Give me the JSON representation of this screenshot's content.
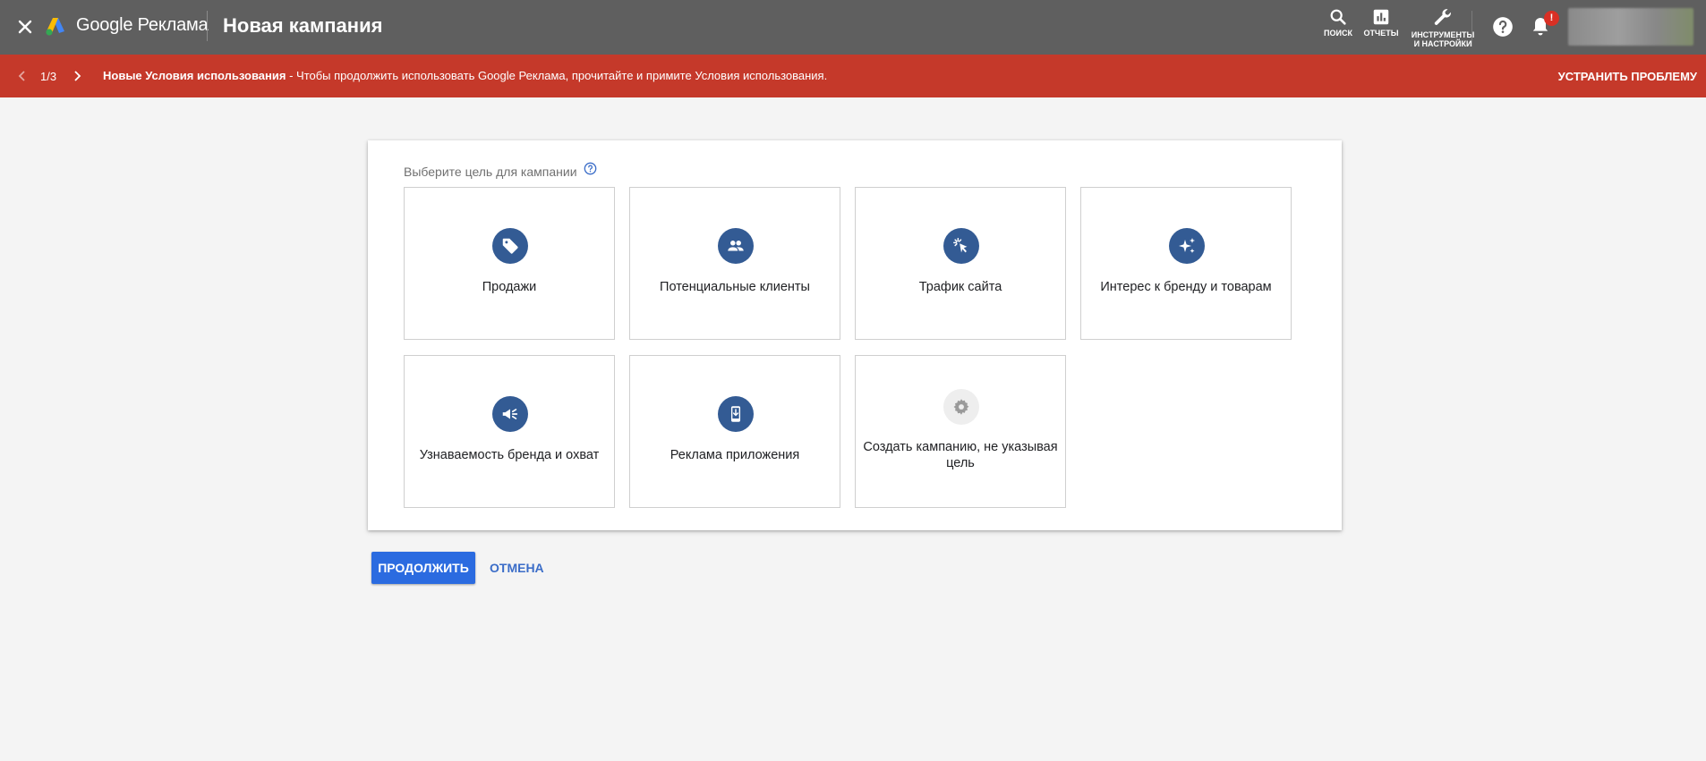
{
  "header": {
    "brand": "Google Реклама",
    "title": "Новая кампания",
    "actions": {
      "search_label": "ПОИСК",
      "reports_label": "ОТЧЕТЫ",
      "tools_label_line1": "ИНСТРУМЕНТЫ",
      "tools_label_line2": "И НАСТРОЙКИ"
    },
    "notification_badge": "!"
  },
  "banner": {
    "counter": "1/3",
    "title": "Новые Условия использования",
    "message": " - Чтобы продолжить использовать Google Реклама, прочитайте и примите Условия использования.",
    "fix_label": "УСТРАНИТЬ ПРОБЛЕМУ",
    "color": "#c5392a"
  },
  "main": {
    "prompt": "Выберите цель для кампании",
    "goals": [
      {
        "label": "Продажи",
        "icon": "tag-icon"
      },
      {
        "label": "Потенциальные клиенты",
        "icon": "people-icon"
      },
      {
        "label": "Трафик сайта",
        "icon": "click-cursor-icon"
      },
      {
        "label": "Интерес к бренду и товарам",
        "icon": "sparkle-icon"
      },
      {
        "label": "Узнаваемость бренда и охват",
        "icon": "megaphone-icon"
      },
      {
        "label": "Реклама приложения",
        "icon": "phone-download-icon"
      },
      {
        "label": "Создать кампанию, не указывая цель",
        "icon": "gear-icon"
      }
    ]
  },
  "buttons": {
    "continue_label": "ПРОДОЛЖИТЬ",
    "cancel_label": "ОТМЕНА"
  },
  "colors": {
    "topbar": "#5f5f5f",
    "accent_blue": "#2b6be0",
    "icon_blue": "#335b94"
  }
}
